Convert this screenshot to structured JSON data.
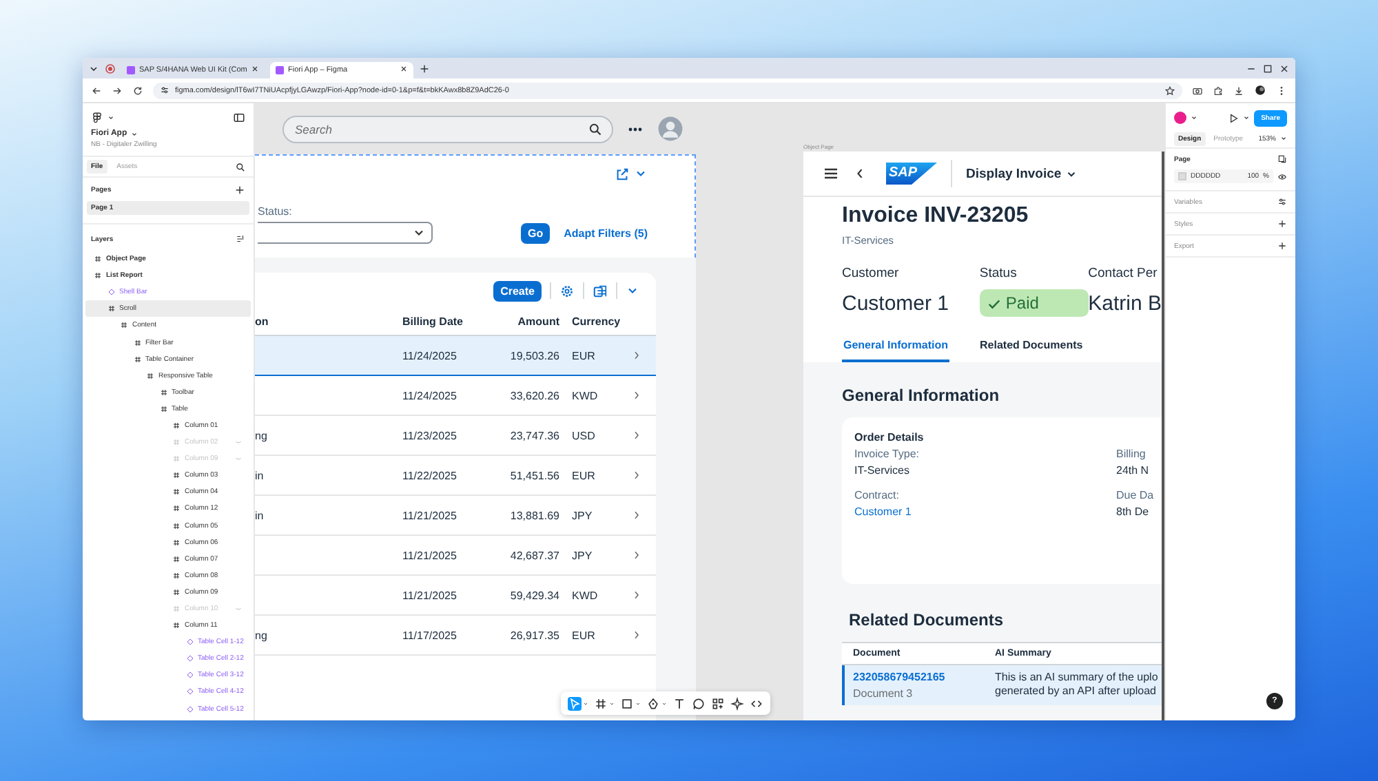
{
  "browser": {
    "tabs": [
      {
        "title": "SAP S/4HANA Web UI Kit (Com",
        "selected": false
      },
      {
        "title": "Fiori App – Figma",
        "selected": true
      }
    ],
    "url": "figma.com/design/lT6wI7TNiUAcpfjyLGAwzp/Fiori-App?node-id=0-1&p=f&t=bkKAwx8b8Z9AdC26-0"
  },
  "figma": {
    "sidebar": {
      "file_name": "Fiori App",
      "team": "NB - Digitaler Zwilling",
      "tabs": [
        {
          "label": "File",
          "selected": true
        },
        {
          "label": "Assets",
          "selected": false
        }
      ],
      "pages_title": "Pages",
      "pages": [
        {
          "name": "Page 1",
          "selected": true
        }
      ],
      "layers_title": "Layers",
      "layers": [
        {
          "name": "Object Page",
          "kind": "frame",
          "selected": false,
          "hidden": false
        },
        {
          "name": "List Report",
          "kind": "frame",
          "selected": false,
          "hidden": false,
          "children": [
            {
              "name": "Shell Bar",
              "kind": "component",
              "selected": false,
              "hidden": false
            },
            {
              "name": "Scroll",
              "kind": "frame",
              "selected": true,
              "hidden": false,
              "children": [
                {
                  "name": "Content",
                  "kind": "frame",
                  "selected": false,
                  "hidden": false,
                  "children": [
                    {
                      "name": "Filter Bar",
                      "kind": "frame",
                      "selected": false,
                      "hidden": false
                    },
                    {
                      "name": "Table Container",
                      "kind": "frame",
                      "selected": false,
                      "hidden": false,
                      "children": [
                        {
                          "name": "Responsive Table",
                          "kind": "frame",
                          "selected": false,
                          "hidden": false,
                          "children": [
                            {
                              "name": "Toolbar",
                              "kind": "frame",
                              "selected": false,
                              "hidden": false
                            },
                            {
                              "name": "Table",
                              "kind": "frame",
                              "selected": false,
                              "hidden": false,
                              "children": [
                                {
                                  "name": "Column 01",
                                  "kind": "frame",
                                  "selected": false,
                                  "hidden": false
                                },
                                {
                                  "name": "Column 02",
                                  "kind": "frame",
                                  "selected": false,
                                  "hidden": true
                                },
                                {
                                  "name": "Column 09",
                                  "kind": "frame",
                                  "selected": false,
                                  "hidden": true
                                },
                                {
                                  "name": "Column 03",
                                  "kind": "frame",
                                  "selected": false,
                                  "hidden": false
                                },
                                {
                                  "name": "Column 04",
                                  "kind": "frame",
                                  "selected": false,
                                  "hidden": false
                                },
                                {
                                  "name": "Column 12",
                                  "kind": "frame",
                                  "selected": false,
                                  "hidden": false
                                },
                                {
                                  "name": "Column 05",
                                  "kind": "frame",
                                  "selected": false,
                                  "hidden": false
                                },
                                {
                                  "name": "Column 06",
                                  "kind": "frame",
                                  "selected": false,
                                  "hidden": false
                                },
                                {
                                  "name": "Column 07",
                                  "kind": "frame",
                                  "selected": false,
                                  "hidden": false
                                },
                                {
                                  "name": "Column 08",
                                  "kind": "frame",
                                  "selected": false,
                                  "hidden": false
                                },
                                {
                                  "name": "Column 09",
                                  "kind": "frame",
                                  "selected": false,
                                  "hidden": false
                                },
                                {
                                  "name": "Column 10",
                                  "kind": "frame",
                                  "selected": false,
                                  "hidden": true
                                },
                                {
                                  "name": "Column 11",
                                  "kind": "frame",
                                  "selected": false,
                                  "hidden": false,
                                  "children": [
                                    {
                                      "name": "Table Cell 1-12",
                                      "kind": "component",
                                      "selected": false,
                                      "hidden": false
                                    },
                                    {
                                      "name": "Table Cell 2-12",
                                      "kind": "component",
                                      "selected": false,
                                      "hidden": false
                                    },
                                    {
                                      "name": "Table Cell 3-12",
                                      "kind": "component",
                                      "selected": false,
                                      "hidden": false
                                    },
                                    {
                                      "name": "Table Cell 4-12",
                                      "kind": "component",
                                      "selected": false,
                                      "hidden": false
                                    },
                                    {
                                      "name": "Table Cell 5-12",
                                      "kind": "component",
                                      "selected": false,
                                      "hidden": false
                                    }
                                  ]
                                }
                              ]
                            }
                          ]
                        }
                      ]
                    }
                  ]
                }
              ]
            }
          ]
        }
      ]
    },
    "canvas": {
      "list_report": {
        "search_placeholder": "Search",
        "status_label": "Status:",
        "go": "Go",
        "adapt_filters": "Adapt Filters (5)",
        "create": "Create",
        "columns": {
          "column_1": "on",
          "billing_date": "Billing Date",
          "amount": "Amount",
          "currency": "Currency"
        },
        "rows": [
          {
            "billing_date": "11/24/2025",
            "amount": "19,503.26",
            "currency": "EUR",
            "selected": true
          },
          {
            "billing_date": "11/24/2025",
            "amount": "33,620.26",
            "currency": "KWD",
            "selected": false
          },
          {
            "column_1": "ng",
            "billing_date": "11/23/2025",
            "amount": "23,747.36",
            "currency": "USD",
            "selected": false
          },
          {
            "column_1": "in",
            "billing_date": "11/22/2025",
            "amount": "51,451.56",
            "currency": "EUR",
            "selected": false
          },
          {
            "column_1": "in",
            "billing_date": "11/21/2025",
            "amount": "13,881.69",
            "currency": "JPY",
            "selected": false
          },
          {
            "billing_date": "11/21/2025",
            "amount": "42,687.37",
            "currency": "JPY",
            "selected": false
          },
          {
            "billing_date": "11/21/2025",
            "amount": "59,429.34",
            "currency": "KWD",
            "selected": false
          },
          {
            "column_1": "ng",
            "billing_date": "11/17/2025",
            "amount": "26,917.35",
            "currency": "EUR",
            "selected": false
          }
        ]
      },
      "object_page": {
        "frame_label": "Object Page",
        "logo": "SAP",
        "app_title": "Display Invoice",
        "heading": "Invoice INV-23205",
        "subtitle": "IT-Services",
        "attributes": [
          {
            "label": "Customer",
            "value": "Customer 1",
            "kind": "text"
          },
          {
            "label": "Status",
            "value": "Paid",
            "kind": "status"
          },
          {
            "label": "Contact Per",
            "value": "Katrin B",
            "kind": "text"
          }
        ],
        "tabs": [
          {
            "label": "General Information",
            "selected": true
          },
          {
            "label": "Related Documents",
            "selected": false
          }
        ],
        "section_title": "General Information",
        "card_title": "Order Details",
        "fields": [
          {
            "label": "Invoice Type:",
            "value": "IT-Services",
            "kind": "text"
          },
          {
            "label": "Billing",
            "value": "24th N",
            "kind": "text"
          },
          {
            "label": "Contract:",
            "value": "Customer 1",
            "kind": "link"
          },
          {
            "label": "Due Da",
            "value": "8th De",
            "kind": "text"
          }
        ],
        "related_title": "Related Documents",
        "doc_columns": [
          "Document",
          "AI Summary"
        ],
        "documents": [
          {
            "number": "232058679452165",
            "name": "Document 3",
            "summary": "This is an AI summary of the uplo\ngenerated by an API after upload",
            "selected": true
          }
        ]
      },
      "tools": [
        {
          "kind": "move",
          "selected": true
        },
        {
          "kind": "frame",
          "selected": false
        },
        {
          "kind": "shape",
          "selected": false
        },
        {
          "kind": "pen",
          "selected": false
        },
        {
          "kind": "text",
          "selected": false
        },
        {
          "kind": "comment",
          "selected": false
        },
        {
          "kind": "actions",
          "selected": false
        },
        {
          "kind": "ai",
          "selected": false
        },
        {
          "kind": "dev",
          "selected": false
        }
      ]
    },
    "properties": {
      "share": "Share",
      "tabs": [
        {
          "label": "Design",
          "selected": true
        },
        {
          "label": "Prototype",
          "selected": false
        }
      ],
      "zoom": "153%",
      "page_title": "Page",
      "page_color": "DDDDDD",
      "opacity": "100",
      "percent": "%",
      "sections": [
        {
          "label": "Variables",
          "kind": "settings"
        },
        {
          "label": "Styles",
          "kind": "add"
        },
        {
          "label": "Export",
          "kind": "add"
        }
      ],
      "help": "?"
    }
  }
}
